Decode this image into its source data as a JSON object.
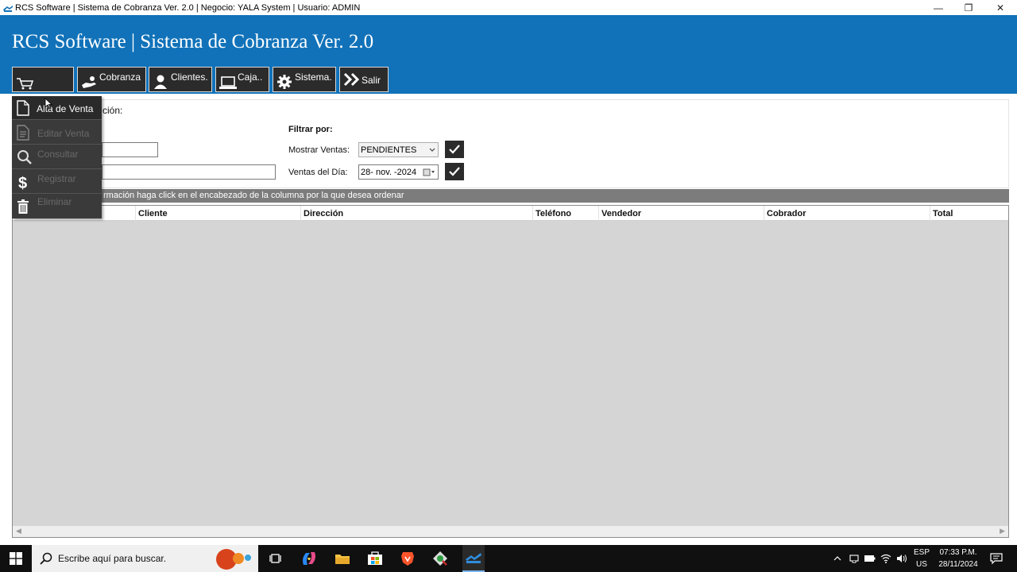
{
  "window": {
    "title": "RCS Software | Sistema de Cobranza Ver. 2.0 | Negocio: YALA System | Usuario: ADMIN",
    "minimize": "—",
    "restore": "❐",
    "close": "✕"
  },
  "header": {
    "app_title": "RCS Software | Sistema de Cobranza Ver. 2.0"
  },
  "toolbar": {
    "cobranza": "Cobranza",
    "clientes": "Clientes.",
    "caja": "Caja..",
    "sistema": "Sistema.",
    "salir": "Salir"
  },
  "menu": {
    "alta_venta": "Alta de Venta",
    "editar_venta": "Editar Venta",
    "consultar": "Consultar",
    "registrar": "Registrar",
    "eliminar": "Eliminar"
  },
  "panel": {
    "partial_label": "ción:",
    "filter_title": "Filtrar por:",
    "mostrar_ventas_label": "Mostrar Ventas:",
    "mostrar_ventas_value": "PENDIENTES",
    "ventas_dia_label": "Ventas del Día:",
    "ventas_dia_value": "28- nov. -2024"
  },
  "hint": "rmación haga click en el encabezado de la columna por la que desea ordenar",
  "grid": {
    "columns": [
      "Cliente",
      "Dirección",
      "Teléfono",
      "Vendedor",
      "Cobrador",
      "Total"
    ]
  },
  "taskbar": {
    "search_placeholder": "Escribe aquí para buscar.",
    "lang_1": "ESP",
    "lang_2": "US",
    "time": "07:33 P.M.",
    "date": "28/11/2024"
  }
}
